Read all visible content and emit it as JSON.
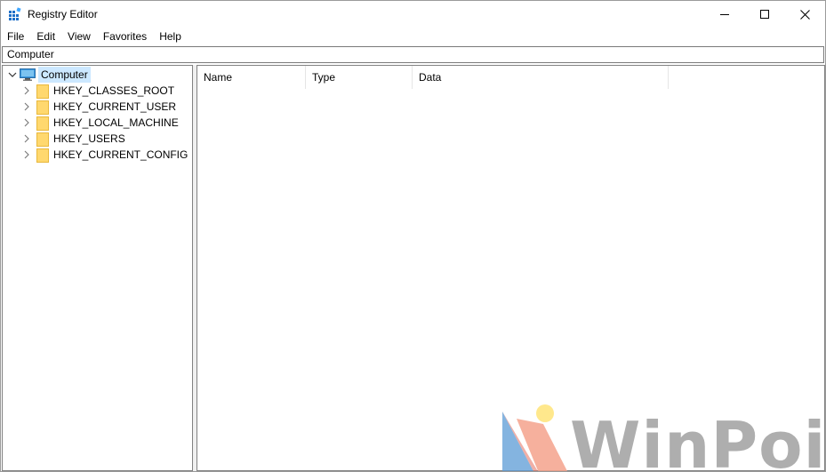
{
  "window": {
    "title": "Registry Editor"
  },
  "menu": {
    "items": [
      "File",
      "Edit",
      "View",
      "Favorites",
      "Help"
    ]
  },
  "address": {
    "path": "Computer"
  },
  "tree": {
    "root": "Computer",
    "children": [
      "HKEY_CLASSES_ROOT",
      "HKEY_CURRENT_USER",
      "HKEY_LOCAL_MACHINE",
      "HKEY_USERS",
      "HKEY_CURRENT_CONFIG"
    ]
  },
  "list": {
    "columns": [
      "Name",
      "Type",
      "Data"
    ]
  },
  "watermark": {
    "text": "WinPoin"
  },
  "colors": {
    "selection": "#cce8ff",
    "folder": "#ffd86e",
    "folder_dark": "#e8b83c",
    "monitor": "#3a96dd"
  }
}
